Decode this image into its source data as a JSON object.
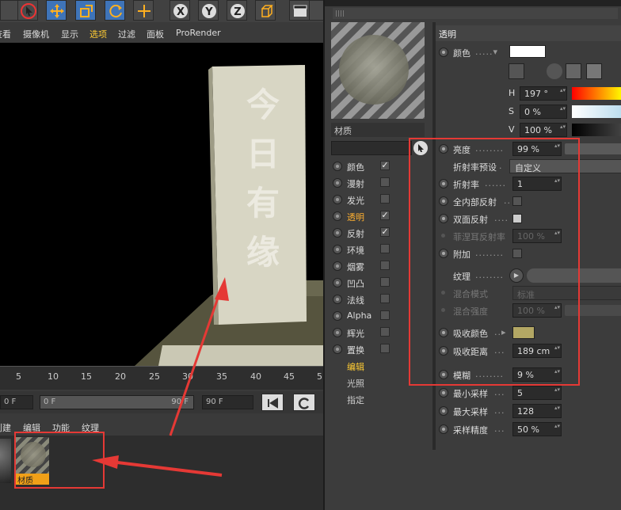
{
  "viewport_menu": [
    "查看",
    "摄像机",
    "显示",
    "选项",
    "过滤",
    "面板",
    "ProRender"
  ],
  "viewport_menu_highlight": "选项",
  "sign_text": [
    "今",
    "日",
    "有",
    "缘"
  ],
  "timeline": {
    "ticks": [
      "5",
      "10",
      "15",
      "20",
      "25",
      "30",
      "35",
      "40",
      "45",
      "5"
    ]
  },
  "playback": {
    "start_field": "0 F",
    "range_left": "0 F",
    "range_right": "90 F",
    "end_field": "90 F"
  },
  "material_menu": [
    "创建",
    "编辑",
    "功能",
    "纹理"
  ],
  "material_thumb_label": "材质",
  "editor": {
    "material_name": "材质",
    "channels": [
      {
        "label": "颜色",
        "checked": true
      },
      {
        "label": "漫射",
        "checked": false
      },
      {
        "label": "发光",
        "checked": false
      },
      {
        "label": "透明",
        "checked": true,
        "active": true
      },
      {
        "label": "反射",
        "checked": true
      },
      {
        "label": "环境",
        "checked": false
      },
      {
        "label": "烟雾",
        "checked": false
      },
      {
        "label": "凹凸",
        "checked": false
      },
      {
        "label": "法线",
        "checked": false
      },
      {
        "label": "Alpha",
        "checked": false
      },
      {
        "label": "辉光",
        "checked": false
      },
      {
        "label": "置换",
        "checked": false
      }
    ],
    "sub_links": [
      "编辑",
      "光照",
      "指定"
    ],
    "section_title": "透明",
    "color_label": "颜色",
    "hsv": {
      "h_label": "H",
      "h_value": "197 °",
      "s_label": "S",
      "s_value": "0 %",
      "v_label": "V",
      "v_value": "100 %"
    },
    "props": {
      "brightness": {
        "label": "亮度",
        "value": "99 %"
      },
      "ior_preset": {
        "label": "折射率预设",
        "value": "自定义"
      },
      "ior": {
        "label": "折射率",
        "value": "1"
      },
      "total_internal": {
        "label": "全内部反射"
      },
      "double_sided": {
        "label": "双面反射"
      },
      "fresnel": {
        "label": "菲涅耳反射率",
        "value": "100 %"
      },
      "additive": {
        "label": "附加"
      },
      "texture": {
        "label": "纹理"
      },
      "mix_mode": {
        "label": "混合模式",
        "value": "标准"
      },
      "mix_strength": {
        "label": "混合强度",
        "value": "100 %"
      },
      "absorption_color": {
        "label": "吸收颜色",
        "color": "#b3a764"
      },
      "absorption_distance": {
        "label": "吸收距离",
        "value": "189 cm"
      },
      "blur": {
        "label": "模糊",
        "value": "9 %"
      },
      "min_samples": {
        "label": "最小采样",
        "value": "5"
      },
      "max_samples": {
        "label": "最大采样",
        "value": "128"
      },
      "sample_accuracy": {
        "label": "采样精度",
        "value": "50 %"
      }
    }
  },
  "colors": {
    "accent_orange": "#ffb030",
    "highlight_yellow": "#ffcc33",
    "annotation_red": "#e53935",
    "sign_color": "#d8d6c4"
  }
}
